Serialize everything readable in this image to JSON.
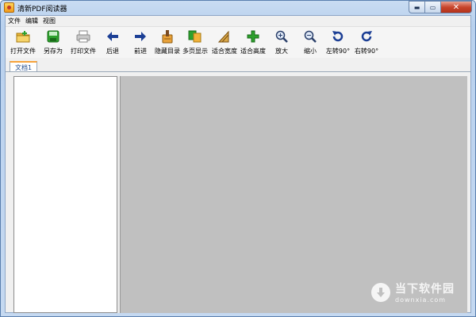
{
  "window": {
    "title": "清新PDF阅读器",
    "controls": {
      "minimize": "▬",
      "maximize": "▭",
      "close": "✕"
    }
  },
  "menu": [
    "文件",
    "编辑",
    "视图"
  ],
  "toolbar": [
    {
      "label": "打开文件",
      "icon": "open-folder-icon"
    },
    {
      "label": "另存为",
      "icon": "save-as-icon"
    },
    {
      "label": "打印文件",
      "icon": "printer-icon"
    },
    {
      "label": "后退",
      "icon": "arrow-left-icon"
    },
    {
      "label": "前进",
      "icon": "arrow-right-icon"
    },
    {
      "label": "隐藏目录",
      "icon": "hide-toc-icon"
    },
    {
      "label": "多页显示",
      "icon": "multi-page-icon"
    },
    {
      "label": "适合宽度",
      "icon": "fit-width-icon"
    },
    {
      "label": "适合高度",
      "icon": "fit-height-icon"
    },
    {
      "label": "放大",
      "icon": "zoom-in-icon"
    },
    {
      "label": "缩小",
      "icon": "zoom-out-icon"
    },
    {
      "label": "左转90°",
      "icon": "rotate-left-icon"
    },
    {
      "label": "右转90°",
      "icon": "rotate-right-icon"
    }
  ],
  "tabs": [
    {
      "label": "文档1",
      "active": true
    }
  ],
  "watermark": {
    "title": "当下软件园",
    "url": "downxia.com"
  },
  "colors": {
    "title_gradient_top": "#c9dcf2",
    "viewer_bg": "#c0c0c0",
    "tab_accent": "#f7a33b",
    "close_button": "#c8452c",
    "icon_blue": "#1c3f95",
    "icon_green": "#2da12d"
  }
}
